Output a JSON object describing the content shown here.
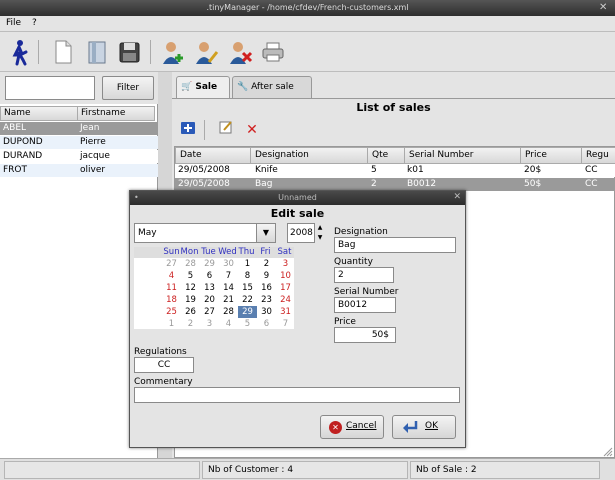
{
  "window": {
    "title": ".tinyManager - /home/cfdev/French-customers.xml"
  },
  "menu": {
    "file": "File",
    "help": "?"
  },
  "toolbar": {
    "icons": [
      "walker-icon",
      "new-file-icon",
      "open-icon",
      "save-icon",
      "add-customer-icon",
      "edit-customer-icon",
      "delete-customer-icon",
      "printer-icon"
    ]
  },
  "left": {
    "filter_value": "",
    "filter_button": "Filter",
    "columns": [
      "Name",
      "Firstname"
    ],
    "customers": [
      {
        "name": "ABEL",
        "firstname": "Jean"
      },
      {
        "name": "DUPOND",
        "firstname": "Pierre"
      },
      {
        "name": "DURAND",
        "firstname": "jacque"
      },
      {
        "name": "FROT",
        "firstname": "oliver"
      }
    ]
  },
  "tabs": [
    {
      "label": "Sale"
    },
    {
      "label": "After sale"
    }
  ],
  "sales": {
    "title": "List of sales",
    "columns": [
      "Date",
      "Designation",
      "Qte",
      "Serial Number",
      "Price",
      "Regu"
    ],
    "rows": [
      {
        "date": "29/05/2008",
        "designation": "Knife",
        "qte": "5",
        "serial": "k01",
        "price": "20$",
        "regu": "CC"
      },
      {
        "date": "29/05/2008",
        "designation": "Bag",
        "qte": "2",
        "serial": "B0012",
        "price": "50$",
        "regu": "CC"
      }
    ]
  },
  "dialog": {
    "window_title": "Unnamed",
    "heading": "Edit sale",
    "month": "May",
    "year": "2008",
    "day_names": [
      "Sun",
      "Mon",
      "Tue",
      "Wed",
      "Thu",
      "Fri",
      "Sat"
    ],
    "weeks": [
      [
        "27",
        "28",
        "29",
        "30",
        "1",
        "2",
        "3"
      ],
      [
        "4",
        "5",
        "6",
        "7",
        "8",
        "9",
        "10"
      ],
      [
        "11",
        "12",
        "13",
        "14",
        "15",
        "16",
        "17"
      ],
      [
        "18",
        "19",
        "20",
        "21",
        "22",
        "23",
        "24"
      ],
      [
        "25",
        "26",
        "27",
        "28",
        "29",
        "30",
        "31"
      ],
      [
        "1",
        "2",
        "3",
        "4",
        "5",
        "6",
        "7"
      ]
    ],
    "selected_day": "29",
    "designation_label": "Designation",
    "designation": "Bag",
    "quantity_label": "Quantity",
    "quantity": "2",
    "serial_label": "Serial Number",
    "serial": "B0012",
    "price_label": "Price",
    "price": "50$",
    "regulations_label": "Regulations",
    "regulations": "CC",
    "commentary_label": "Commentary",
    "commentary": "",
    "cancel": "Cancel",
    "ok": "OK"
  },
  "status": {
    "customers": "Nb of Customer : 4",
    "sales": "Nb of Sale : 2"
  },
  "colors": {
    "selection": "#9a9a9a",
    "alt_row": "#eaf2fb",
    "weekend": "#cc2020",
    "day_header": "#3030c0"
  }
}
